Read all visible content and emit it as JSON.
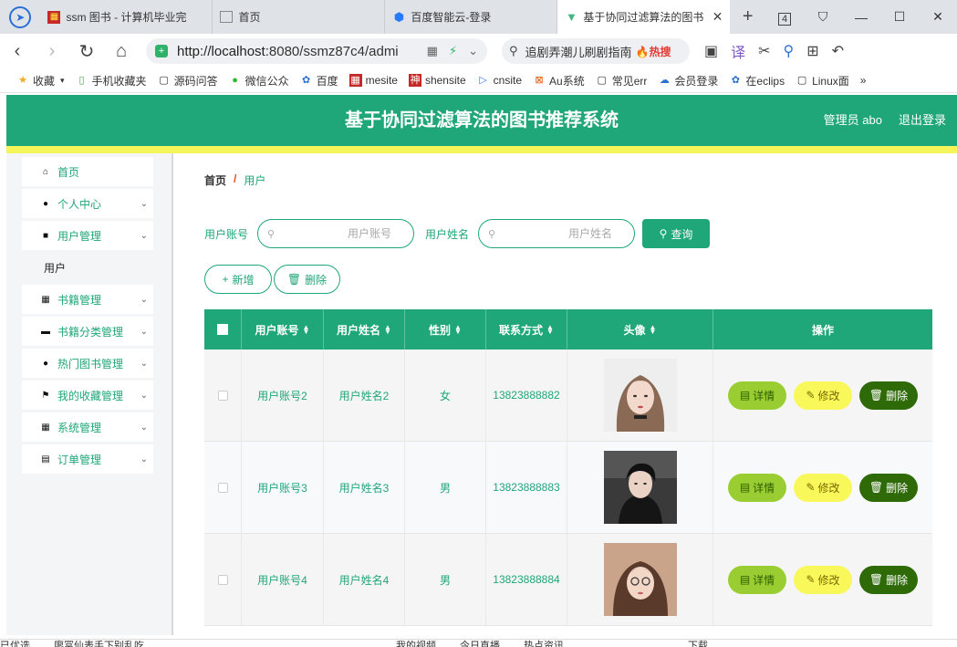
{
  "browser": {
    "tabs": [
      {
        "title": "ssm 图书 - 计算机毕业完",
        "active": false,
        "favicon": "red-square-icon"
      },
      {
        "title": "首页",
        "active": false,
        "favicon": "page-icon"
      },
      {
        "title": "百度智能云-登录",
        "active": false,
        "favicon": "hexagon-icon"
      },
      {
        "title": "基于协同过滤算法的图书",
        "active": true,
        "favicon": "vue-icon"
      }
    ],
    "url_host": "http://localhost",
    "url_rest": ":8080/ssmz87c4/admi",
    "search_text": "追剧弄潮儿刷剧指南",
    "search_hot": "热搜",
    "tab_count": "4",
    "bookmarks": [
      "收藏",
      "手机收藏夹",
      "源码问答",
      "微信公众",
      "百度",
      "mesite",
      "shensite",
      "cnsite",
      "Au系统",
      "常见err",
      "会员登录",
      "在eclips",
      "Linux面"
    ],
    "more": "»",
    "statusbar": [
      "已优选",
      "廖冨仙表手下别乱吃",
      "我的视频",
      "今日直播",
      "热点资讯",
      "下载"
    ]
  },
  "header": {
    "title": "基于协同过滤算法的图书推荐系统",
    "user": "管理员 abo",
    "logout": "退出登录"
  },
  "sidebar": {
    "items": [
      {
        "label": "首页",
        "icon": "home-icon",
        "has_children": false
      },
      {
        "label": "个人中心",
        "icon": "user-icon",
        "has_children": true
      },
      {
        "label": "用户管理",
        "icon": "folder-icon",
        "has_children": true
      },
      {
        "label": "书籍管理",
        "icon": "grid-icon",
        "has_children": true
      },
      {
        "label": "书籍分类管理",
        "icon": "monitor-icon",
        "has_children": true
      },
      {
        "label": "热门图书管理",
        "icon": "bulb-icon",
        "has_children": true
      },
      {
        "label": "我的收藏管理",
        "icon": "flag-icon",
        "has_children": true
      },
      {
        "label": "系统管理",
        "icon": "apps-icon",
        "has_children": true
      },
      {
        "label": "订单管理",
        "icon": "clipboard-icon",
        "has_children": true
      }
    ],
    "sub_item": "用户"
  },
  "breadcrumb": {
    "home": "首页",
    "sep": "/",
    "current": "用户"
  },
  "search": {
    "account_label": "用户账号",
    "account_placeholder": "用户账号",
    "name_label": "用户姓名",
    "name_placeholder": "用户姓名",
    "query_button": "查询"
  },
  "actions": {
    "add": "新增",
    "delete": "删除"
  },
  "table": {
    "headers": [
      "用户账号",
      "用户姓名",
      "性别",
      "联系方式",
      "头像",
      "操作"
    ],
    "rows": [
      {
        "account": "用户账号2",
        "name": "用户姓名2",
        "gender": "女",
        "phone": "13823888882"
      },
      {
        "account": "用户账号3",
        "name": "用户姓名3",
        "gender": "男",
        "phone": "13823888883"
      },
      {
        "account": "用户账号4",
        "name": "用户姓名4",
        "gender": "男",
        "phone": "13823888884"
      }
    ],
    "row_actions": {
      "detail": "详情",
      "edit": "修改",
      "remove": "删除"
    }
  },
  "colors": {
    "primary": "#1fa679",
    "accent_yellow": "#f5f55a",
    "detail_btn": "#9acd32",
    "edit_btn": "#f8f85a",
    "remove_btn": "#2e6a07"
  }
}
